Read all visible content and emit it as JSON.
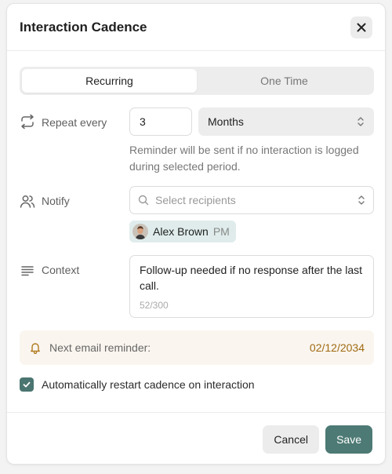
{
  "dialog": {
    "title": "Interaction Cadence"
  },
  "mode_tabs": [
    {
      "label": "Recurring",
      "active": true
    },
    {
      "label": "One Time",
      "active": false
    }
  ],
  "repeat": {
    "label": "Repeat every",
    "value": "3",
    "unit": "Months",
    "helper": "Reminder will be sent if no interaction is logged during selected period."
  },
  "notify": {
    "label": "Notify",
    "placeholder": "Select recipients",
    "recipients": [
      {
        "name": "Alex Brown",
        "role": "PM"
      }
    ]
  },
  "context": {
    "label": "Context",
    "text": "Follow-up needed if no response after the last call.",
    "counter": "52/300"
  },
  "reminder": {
    "label": "Next email reminder:",
    "date": "02/12/2034"
  },
  "auto_restart": {
    "label": "Automatically restart cadence on interaction",
    "checked": true
  },
  "footer": {
    "cancel_label": "Cancel",
    "save_label": "Save"
  },
  "colors": {
    "accent": "#4d7a74",
    "chip_bg": "#dfeceb",
    "reminder_bg": "#faf5ef",
    "reminder_date": "#a06b13"
  },
  "icons": {
    "close": "close-icon",
    "repeat": "repeat-icon",
    "notify": "users-icon",
    "context": "align-left-icon",
    "search": "search-icon",
    "select": "chevron-up-down-icon",
    "bell": "bell-icon",
    "check": "check-icon"
  }
}
